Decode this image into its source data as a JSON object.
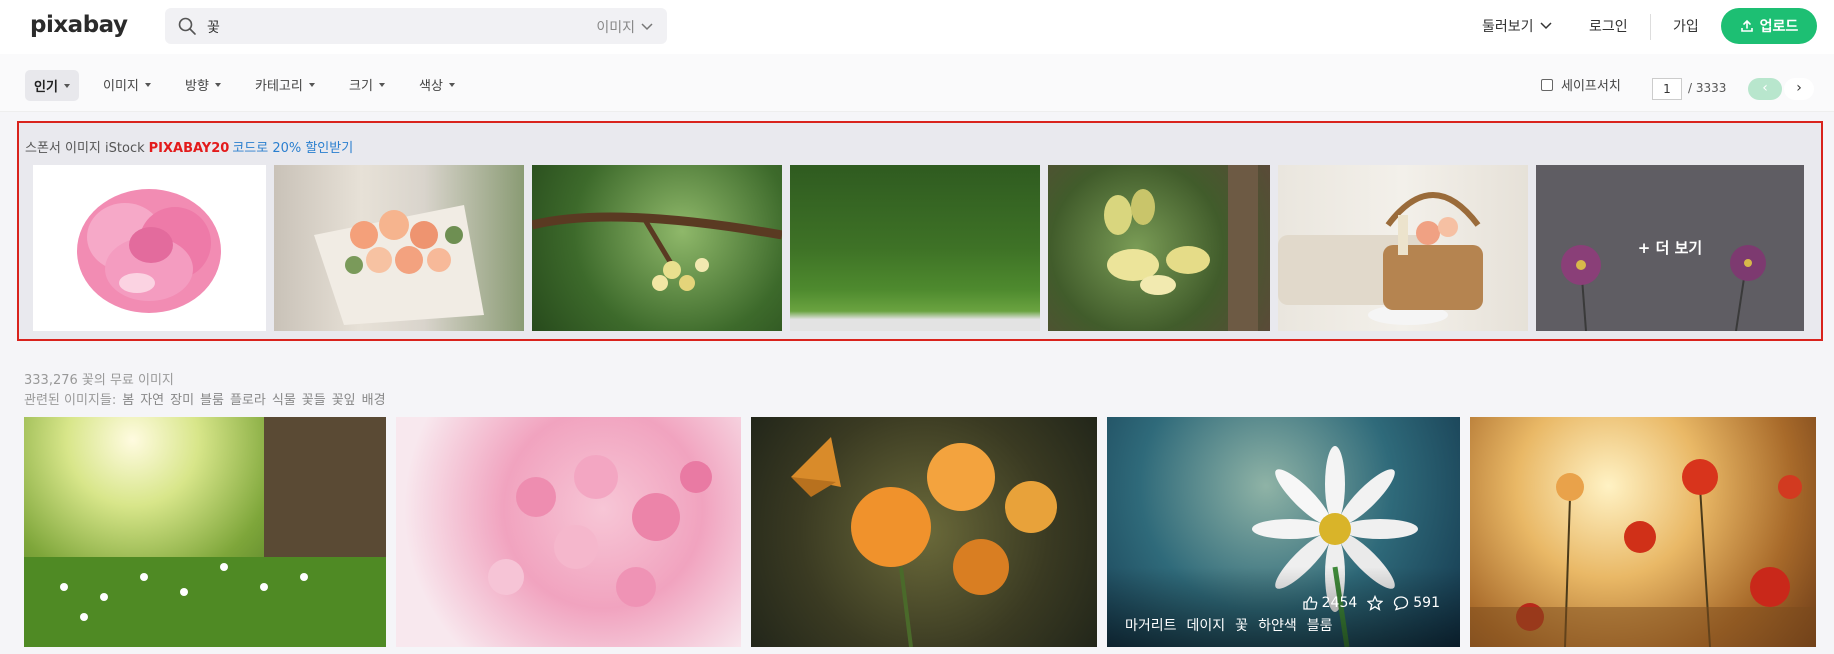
{
  "header": {
    "logo": "pixabay",
    "search": {
      "query": "꽃",
      "scope": "이미지"
    },
    "nav": {
      "explore": "둘러보기",
      "login": "로그인",
      "join": "가입",
      "upload": "업로드"
    }
  },
  "filters": {
    "items": [
      "인기",
      "이미지",
      "방향",
      "카테고리",
      "크기",
      "색상"
    ],
    "safesearch": "세이프서치",
    "pagination": {
      "current": "1",
      "total": "/ 3333",
      "prev": "‹",
      "next": "›"
    }
  },
  "sponsor": {
    "label": "스폰서 이미지 iStock",
    "code": "PIXABAY20",
    "promo": "코드로 20% 할인받기",
    "more": "+ 더 보기"
  },
  "results": {
    "count_text": "333,276 꽃의 무료 이미지",
    "related_label": "관련된 이미지들:",
    "related": [
      "봄",
      "자연",
      "장미",
      "블룸",
      "플로라",
      "식물",
      "꽃들",
      "꽃잎",
      "배경"
    ],
    "hover_item": {
      "likes": "2454",
      "comments": "591",
      "tags": [
        "마거리트",
        "데이지",
        "꽃",
        "하얀색",
        "블룸"
      ]
    }
  },
  "colors": {
    "accent": "#1dbf73",
    "sponsor_border": "#d9231d",
    "code_red": "#e31b1b",
    "promo_blue": "#2a7fcf"
  }
}
